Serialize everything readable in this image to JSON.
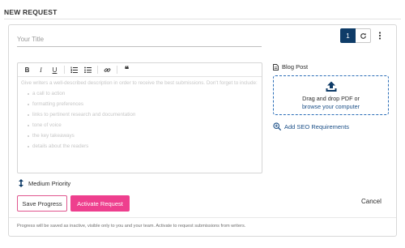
{
  "header": {
    "title": "NEW REQUEST"
  },
  "form": {
    "title_placeholder": "Your Title",
    "title_value": ""
  },
  "controls": {
    "count": "1",
    "refresh_icon": "refresh-icon",
    "more_icon": "kebab-icon"
  },
  "editor": {
    "toolbar": [
      {
        "name": "bold",
        "glyph": "B"
      },
      {
        "name": "italic",
        "glyph": "I"
      },
      {
        "name": "underline",
        "glyph": "U"
      },
      {
        "name": "ordered-list",
        "glyph": ""
      },
      {
        "name": "bullet-list",
        "glyph": ""
      },
      {
        "name": "link",
        "glyph": ""
      },
      {
        "name": "blockquote",
        "glyph": "❝"
      }
    ],
    "placeholder_intro": "Give writers a well-described description in order to receive the best submissions. Don't forget to include:",
    "placeholder_items": [
      "a call to action",
      "formatting preferences",
      "links to pertinent research and documentation",
      "tone of voice",
      "the key takeaways",
      "details about the readers"
    ]
  },
  "priority": {
    "label": "Medium Priority"
  },
  "actions": {
    "save": "Save Progress",
    "activate": "Activate Request",
    "cancel": "Cancel"
  },
  "footer": {
    "note": "Progress will be saved as inactive, visible only to you and your team. Activate to request submissions from writers."
  },
  "sidebar": {
    "content_type": "Blog Post",
    "upload_line1": "Drag and drop PDF or",
    "upload_line2": "browse your computer",
    "seo_link": "Add SEO Requirements"
  },
  "colors": {
    "primary_dark": "#0f3c68",
    "accent_pink": "#ee3f8e",
    "link_blue": "#1b4f87"
  }
}
